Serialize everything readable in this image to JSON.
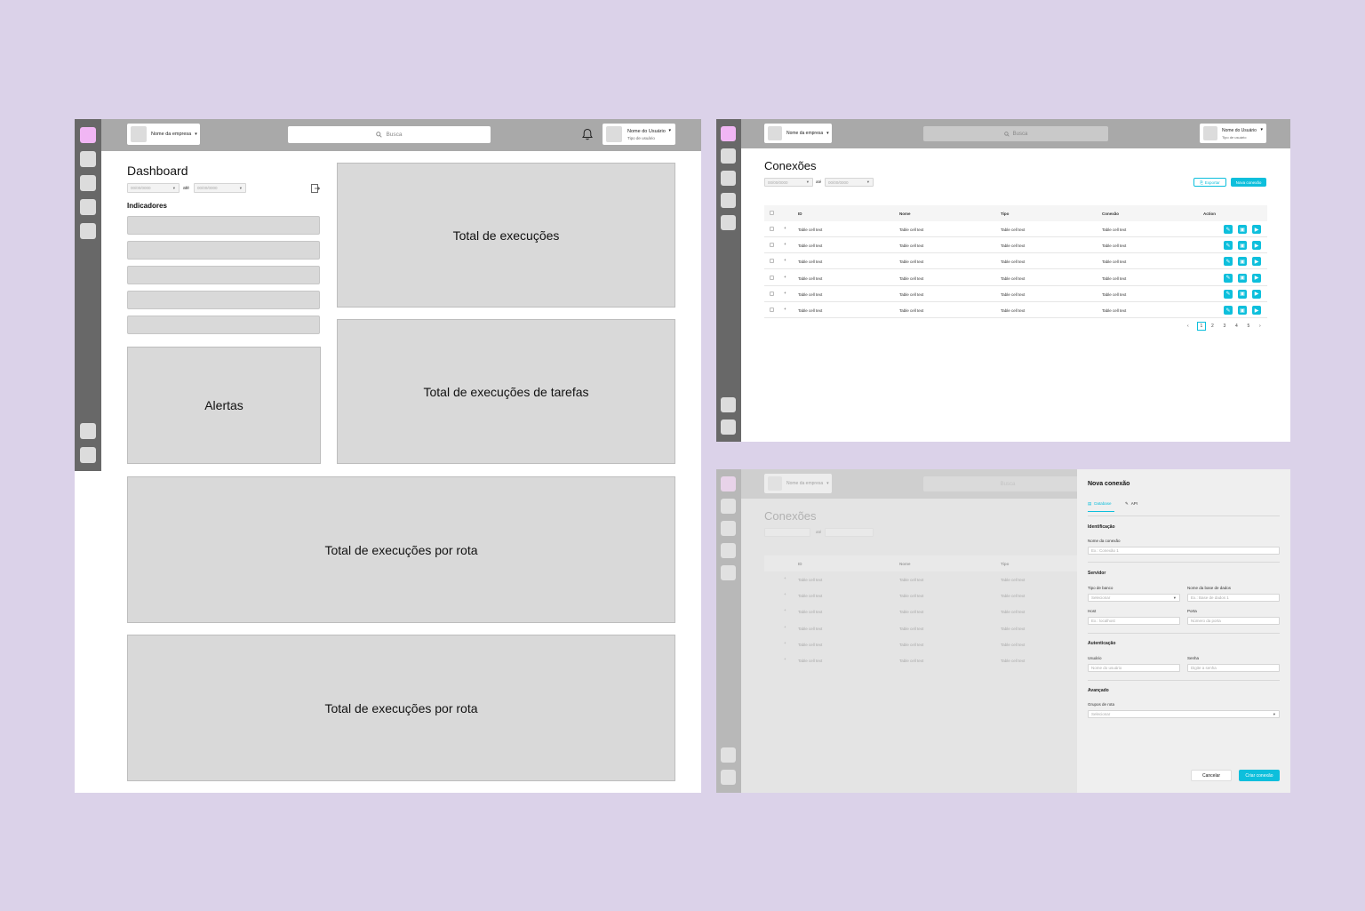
{
  "common": {
    "company_name": "Nome da empresa",
    "search_placeholder": "Busca",
    "user_name": "Nome do Usuário",
    "user_type": "Tipo de usuário",
    "caret": "▾",
    "ate": "até",
    "date_placeholder": "00/00/0000"
  },
  "dashboard": {
    "title": "Dashboard",
    "indicadores": "Indicadores",
    "cards": {
      "total_execucoes": "Total de execuções",
      "alertas": "Alertas",
      "total_tarefas": "Total de execuções de tarefas",
      "total_rota_1": "Total de execuções por rota",
      "total_rota_2": "Total de execuções por rota"
    }
  },
  "conexoes": {
    "title": "Conexões",
    "exportar": "Exportar",
    "nova_conexao": "Nova conexão",
    "columns": [
      "ID",
      "Nome",
      "Tipo",
      "Conexão",
      "Action"
    ],
    "cell_text": "Table cell text",
    "rows": [
      [
        "Table cell text",
        "Table cell text",
        "Table cell text",
        "Table cell text"
      ],
      [
        "Table cell text",
        "Table cell text",
        "Table cell text",
        "Table cell text"
      ],
      [
        "Table cell text",
        "Table cell text",
        "Table cell text",
        "Table cell text"
      ],
      [
        "Table cell text",
        "Table cell text",
        "Table cell text",
        "Table cell text"
      ],
      [
        "Table cell text",
        "Table cell text",
        "Table cell text",
        "Table cell text"
      ],
      [
        "Table cell text",
        "Table cell text",
        "Table cell text",
        "Table cell text"
      ]
    ],
    "pagination": [
      "‹",
      "1",
      "2",
      "3",
      "4",
      "5",
      "›"
    ],
    "active_page": "1"
  },
  "drawer": {
    "title": "Nova conexão",
    "tabs": [
      "Database",
      "API"
    ],
    "active_tab": "Database",
    "identificacao": "Identificação",
    "nome_conexao_label": "Nome da conexão",
    "nome_conexao_ph": "Ex.: Conexão 1",
    "servidor": "Servidor",
    "tipo_banco_label": "Tipo de banco",
    "tipo_banco_value": "Selecionar",
    "nome_base_label": "Nome da base de dados",
    "nome_base_ph": "Ex.: Base de dados 1",
    "host_label": "Host",
    "host_ph": "Ex.: localhost",
    "porta_label": "Porta",
    "porta_ph": "Número da porta",
    "autenticacao": "Autenticação",
    "usuario_label": "Usuário",
    "usuario_ph": "Nome do usuário",
    "senha_label": "Senha",
    "senha_ph": "Digite a senha",
    "avancado": "Avançado",
    "grupos_label": "Grupos de rota",
    "grupos_value": "Selecionar",
    "cancelar": "Cancelar",
    "criar": "Criar conexão"
  },
  "colors": {
    "background": "#dbd2e9",
    "accent": "#0dbfdc",
    "rail": "#686868",
    "topbar": "#a9a9a9",
    "active_nav": "#f1b6f4"
  }
}
